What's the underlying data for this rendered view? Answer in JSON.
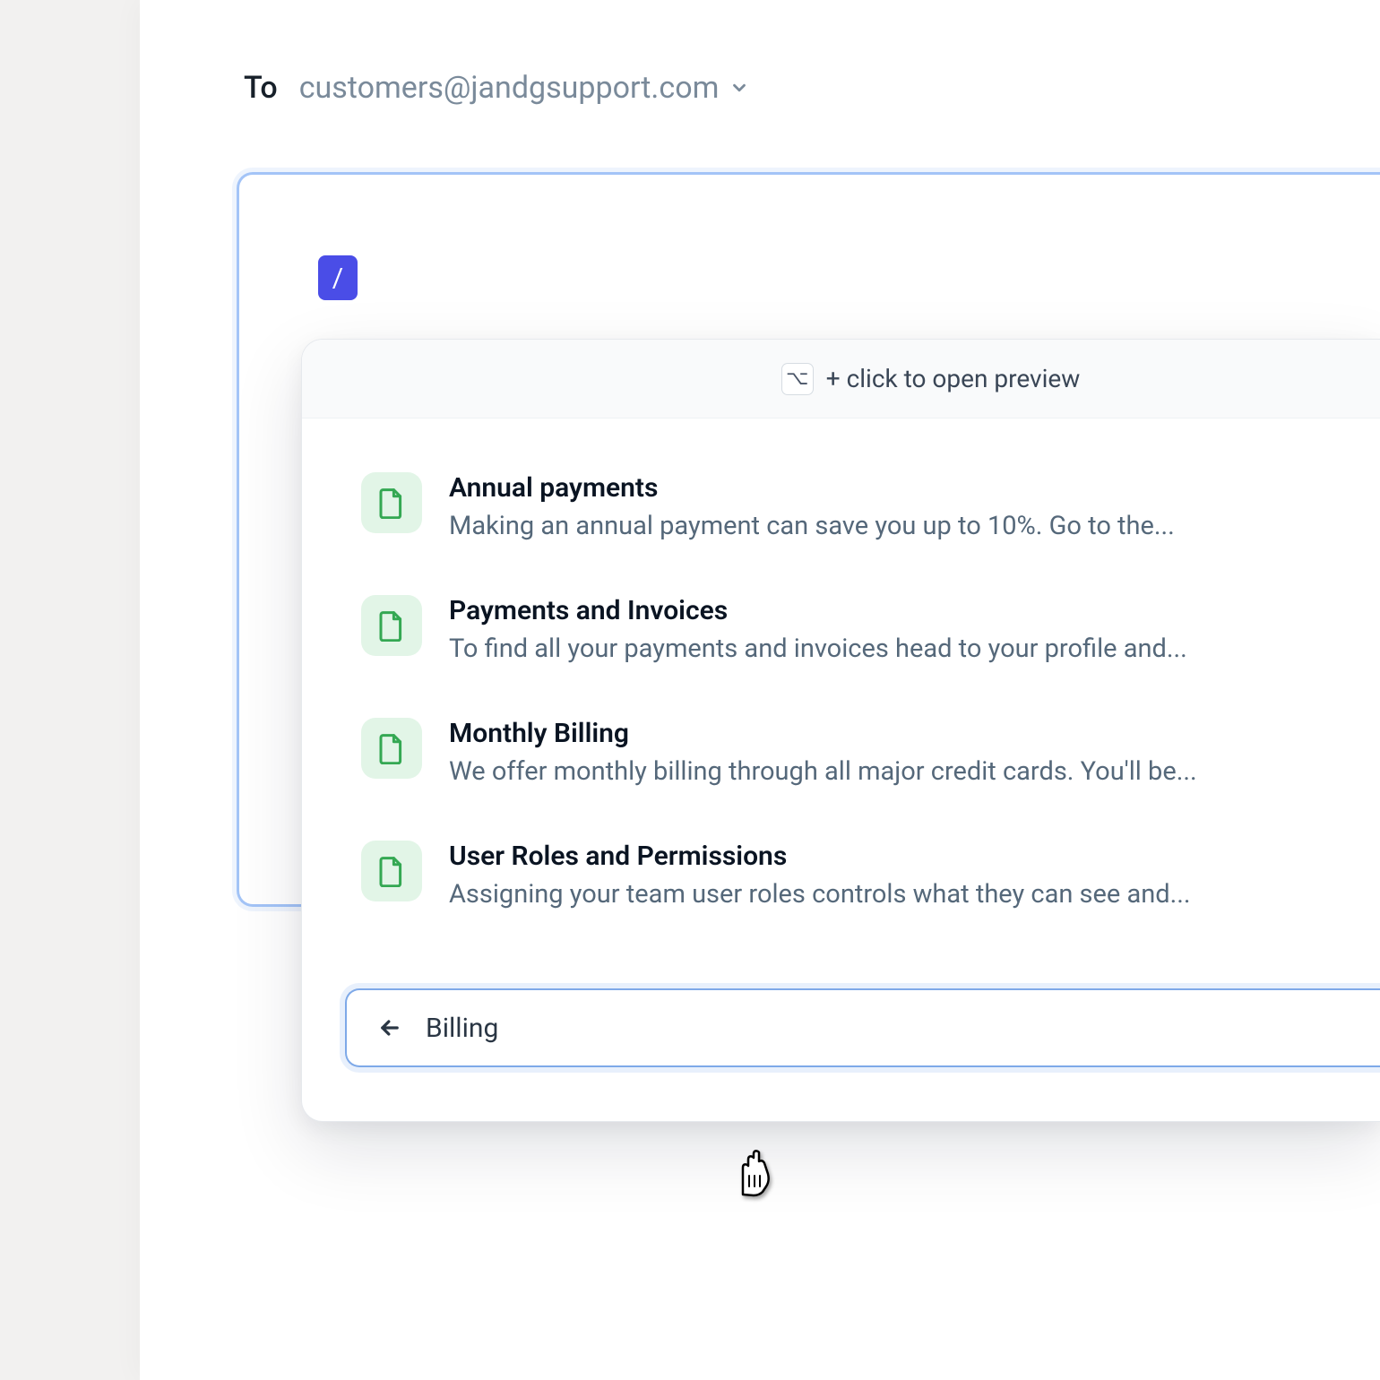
{
  "to": {
    "label": "To",
    "email": "customers@jandgsupport.com"
  },
  "compose": {
    "slash": "/"
  },
  "hint": {
    "key": "⌥",
    "text": "+ click to open preview"
  },
  "suggestions": [
    {
      "title": "Annual payments",
      "desc": "Making an annual payment can save you up to 10%. Go to the..."
    },
    {
      "title": "Payments and Invoices",
      "desc": "To find all your payments and invoices head to your profile and..."
    },
    {
      "title": "Monthly Billing",
      "desc": "We offer monthly billing through all major credit cards. You'll be..."
    },
    {
      "title": "User Roles and Permissions",
      "desc": "Assigning your team user roles controls what they can see and..."
    }
  ],
  "search": {
    "value": "Billing"
  }
}
